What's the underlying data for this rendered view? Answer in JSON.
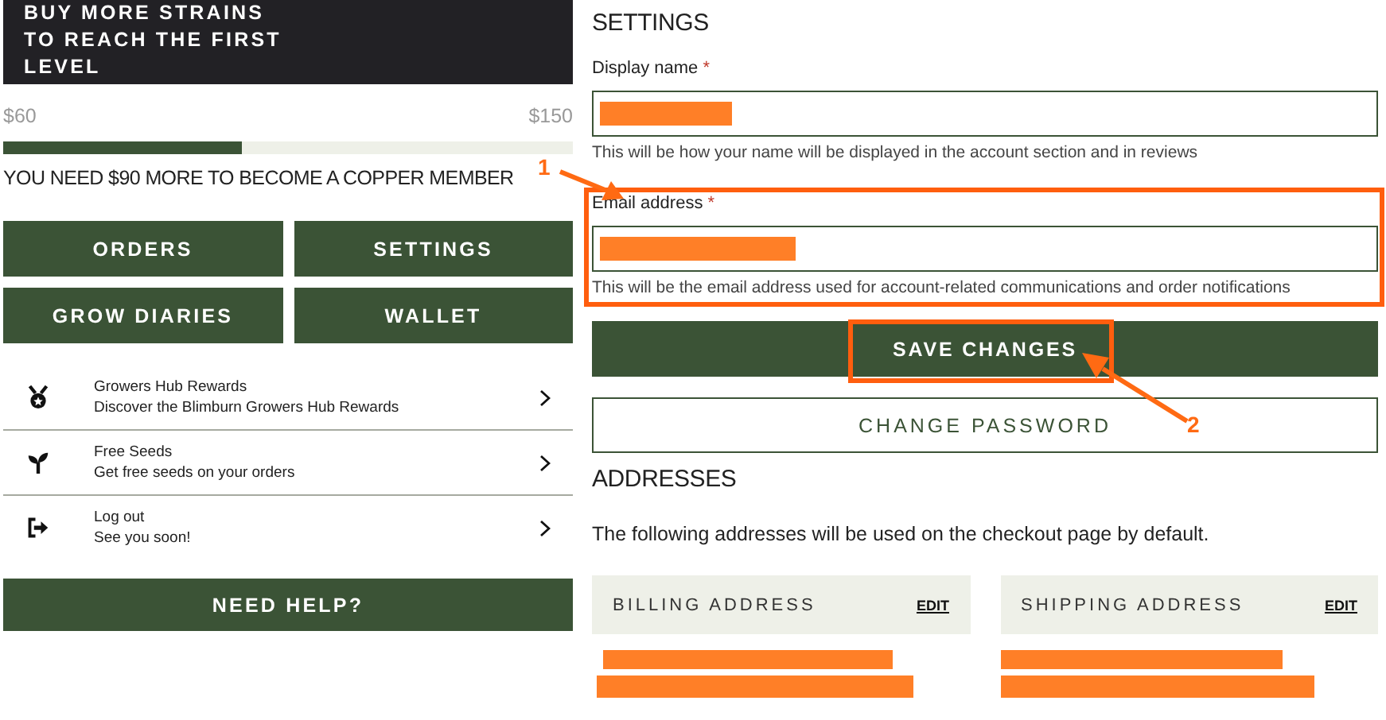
{
  "banner": {
    "title": "BUY MORE STRAINS TO REACH THE FIRST LEVEL"
  },
  "progress": {
    "start": "$60",
    "end": "$150",
    "level": 0.42,
    "message": "YOU NEED $90 MORE TO BECOME A COPPER MEMBER"
  },
  "nav_buttons": [
    "ORDERS",
    "SETTINGS",
    "GROW DIARIES",
    "WALLET"
  ],
  "menu": [
    {
      "kind": "medal",
      "title": "Growers Hub Rewards",
      "subtitle": "Discover the Blimburn Growers Hub Rewards"
    },
    {
      "kind": "sprout",
      "title": "Free Seeds",
      "subtitle": "Get free seeds on your orders"
    },
    {
      "kind": "logout",
      "title": "Log out",
      "subtitle": "See you soon!"
    }
  ],
  "help_button": "NEED HELP?",
  "settings": {
    "title": "SETTINGS",
    "fields": [
      {
        "label": "Display name",
        "required": "*",
        "redacted": true,
        "hint": "This will be how your name will be displayed in the account section and in reviews",
        "highlighted": false
      },
      {
        "label": "Email address",
        "required": "*",
        "redacted": true,
        "hint": "This will be the email address used for account-related communications and order notifications",
        "highlighted": true
      }
    ],
    "save_button": "SAVE CHANGES",
    "save_highlighted": true,
    "password_button": "CHANGE PASSWORD"
  },
  "addresses": {
    "title": "ADDRESSES",
    "description": "The following addresses will be used on the checkout page by default.",
    "cards": [
      {
        "title": "BILLING ADDRESS",
        "edit": "EDIT",
        "redacted": true
      },
      {
        "title": "SHIPPING ADDRESS",
        "edit": "EDIT",
        "redacted": true
      }
    ]
  },
  "annotations": [
    {
      "label": "1"
    },
    {
      "label": "2"
    }
  ]
}
